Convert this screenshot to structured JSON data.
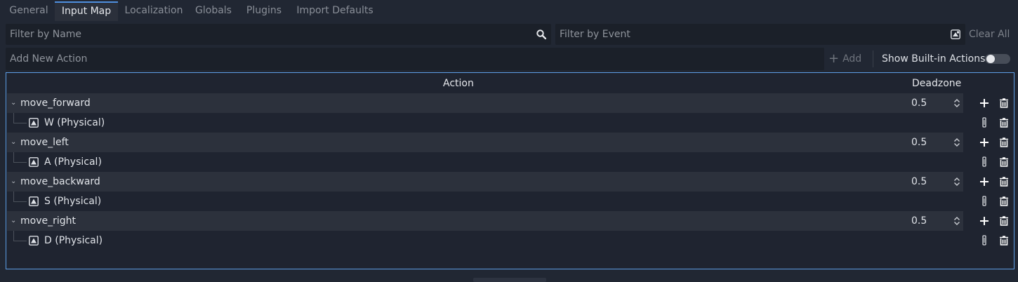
{
  "tabs": [
    {
      "label": "General",
      "active": false
    },
    {
      "label": "Input Map",
      "active": true
    },
    {
      "label": "Localization",
      "active": false
    },
    {
      "label": "Globals",
      "active": false
    },
    {
      "label": "Plugins",
      "active": false
    },
    {
      "label": "Import Defaults",
      "active": false
    }
  ],
  "filters": {
    "name_placeholder": "Filter by Name",
    "event_placeholder": "Filter by Event",
    "clear_label": "Clear All",
    "name_icon": "search-icon",
    "event_icon": "keyboard-icon"
  },
  "add_action": {
    "placeholder": "Add New Action",
    "add_label": "Add",
    "show_builtin_label": "Show Built-in Actions",
    "show_builtin_on": false
  },
  "tree": {
    "headers": {
      "action": "Action",
      "deadzone": "Deadzone"
    },
    "actions": [
      {
        "name": "move_forward",
        "deadzone": "0.5",
        "event": "W (Physical)"
      },
      {
        "name": "move_left",
        "deadzone": "0.5",
        "event": "A (Physical)"
      },
      {
        "name": "move_backward",
        "deadzone": "0.5",
        "event": "S (Physical)"
      },
      {
        "name": "move_right",
        "deadzone": "0.5",
        "event": "D (Physical)"
      }
    ]
  },
  "colors": {
    "accent": "#4f8fde",
    "background": "#212733",
    "field": "#1b2029",
    "row_action": "#2c313c"
  }
}
